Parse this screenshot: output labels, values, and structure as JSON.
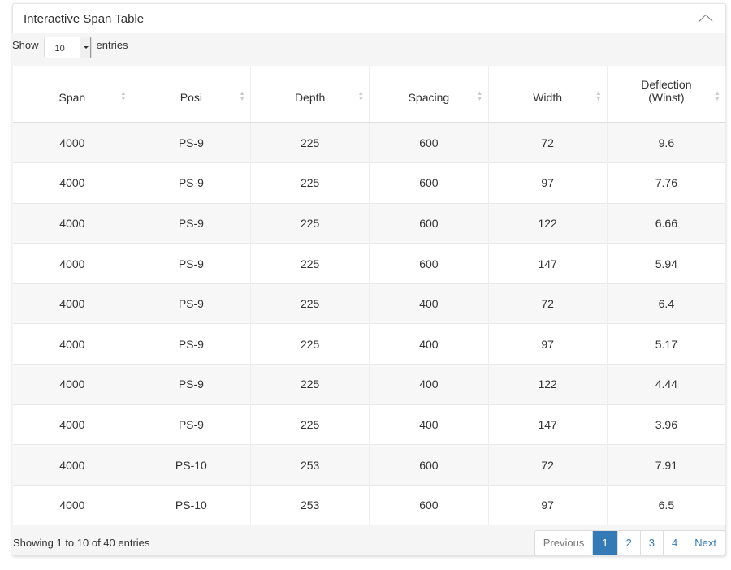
{
  "panel": {
    "title": "Interactive Span Table",
    "collapse_icon": "chevron-up-icon"
  },
  "length": {
    "show": "Show",
    "value": "10",
    "entries": "entries"
  },
  "columns": [
    "Span",
    "Posi",
    "Depth",
    "Spacing",
    "Width",
    "Deflection (Winst)"
  ],
  "rows": [
    [
      "4000",
      "PS-9",
      "225",
      "600",
      "72",
      "9.6"
    ],
    [
      "4000",
      "PS-9",
      "225",
      "600",
      "97",
      "7.76"
    ],
    [
      "4000",
      "PS-9",
      "225",
      "600",
      "122",
      "6.66"
    ],
    [
      "4000",
      "PS-9",
      "225",
      "600",
      "147",
      "5.94"
    ],
    [
      "4000",
      "PS-9",
      "225",
      "400",
      "72",
      "6.4"
    ],
    [
      "4000",
      "PS-9",
      "225",
      "400",
      "97",
      "5.17"
    ],
    [
      "4000",
      "PS-9",
      "225",
      "400",
      "122",
      "4.44"
    ],
    [
      "4000",
      "PS-9",
      "225",
      "400",
      "147",
      "3.96"
    ],
    [
      "4000",
      "PS-10",
      "253",
      "600",
      "72",
      "7.91"
    ],
    [
      "4000",
      "PS-10",
      "253",
      "600",
      "97",
      "6.5"
    ]
  ],
  "footer": {
    "info": "Showing 1 to 10 of 40 entries",
    "previous": "Previous",
    "pages": [
      "1",
      "2",
      "3",
      "4"
    ],
    "active_page": "1",
    "next": "Next"
  },
  "colors": {
    "accent": "#337ab7"
  }
}
